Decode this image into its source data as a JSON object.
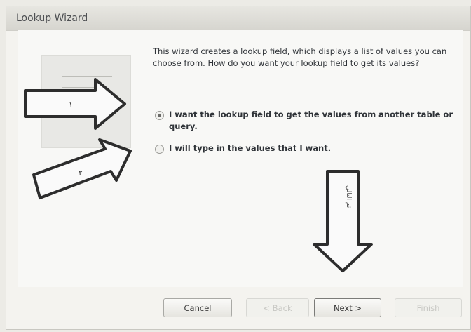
{
  "window": {
    "title": "Lookup Wizard"
  },
  "intro_text": "This wizard creates a lookup field, which displays a list of values you can choose from.  How do you want your lookup field to get its values?",
  "options": [
    {
      "label": "I want the lookup field to get the values from another table or query.",
      "checked": true
    },
    {
      "label": "I will type in the values that I want.",
      "checked": false
    }
  ],
  "buttons": {
    "cancel": "Cancel",
    "back": "< Back",
    "next": "Next >",
    "finish": "Finish"
  },
  "annotations": {
    "arrow1_label": "١",
    "arrow2_label": "٢",
    "arrow3_label": "ثم التالي"
  }
}
